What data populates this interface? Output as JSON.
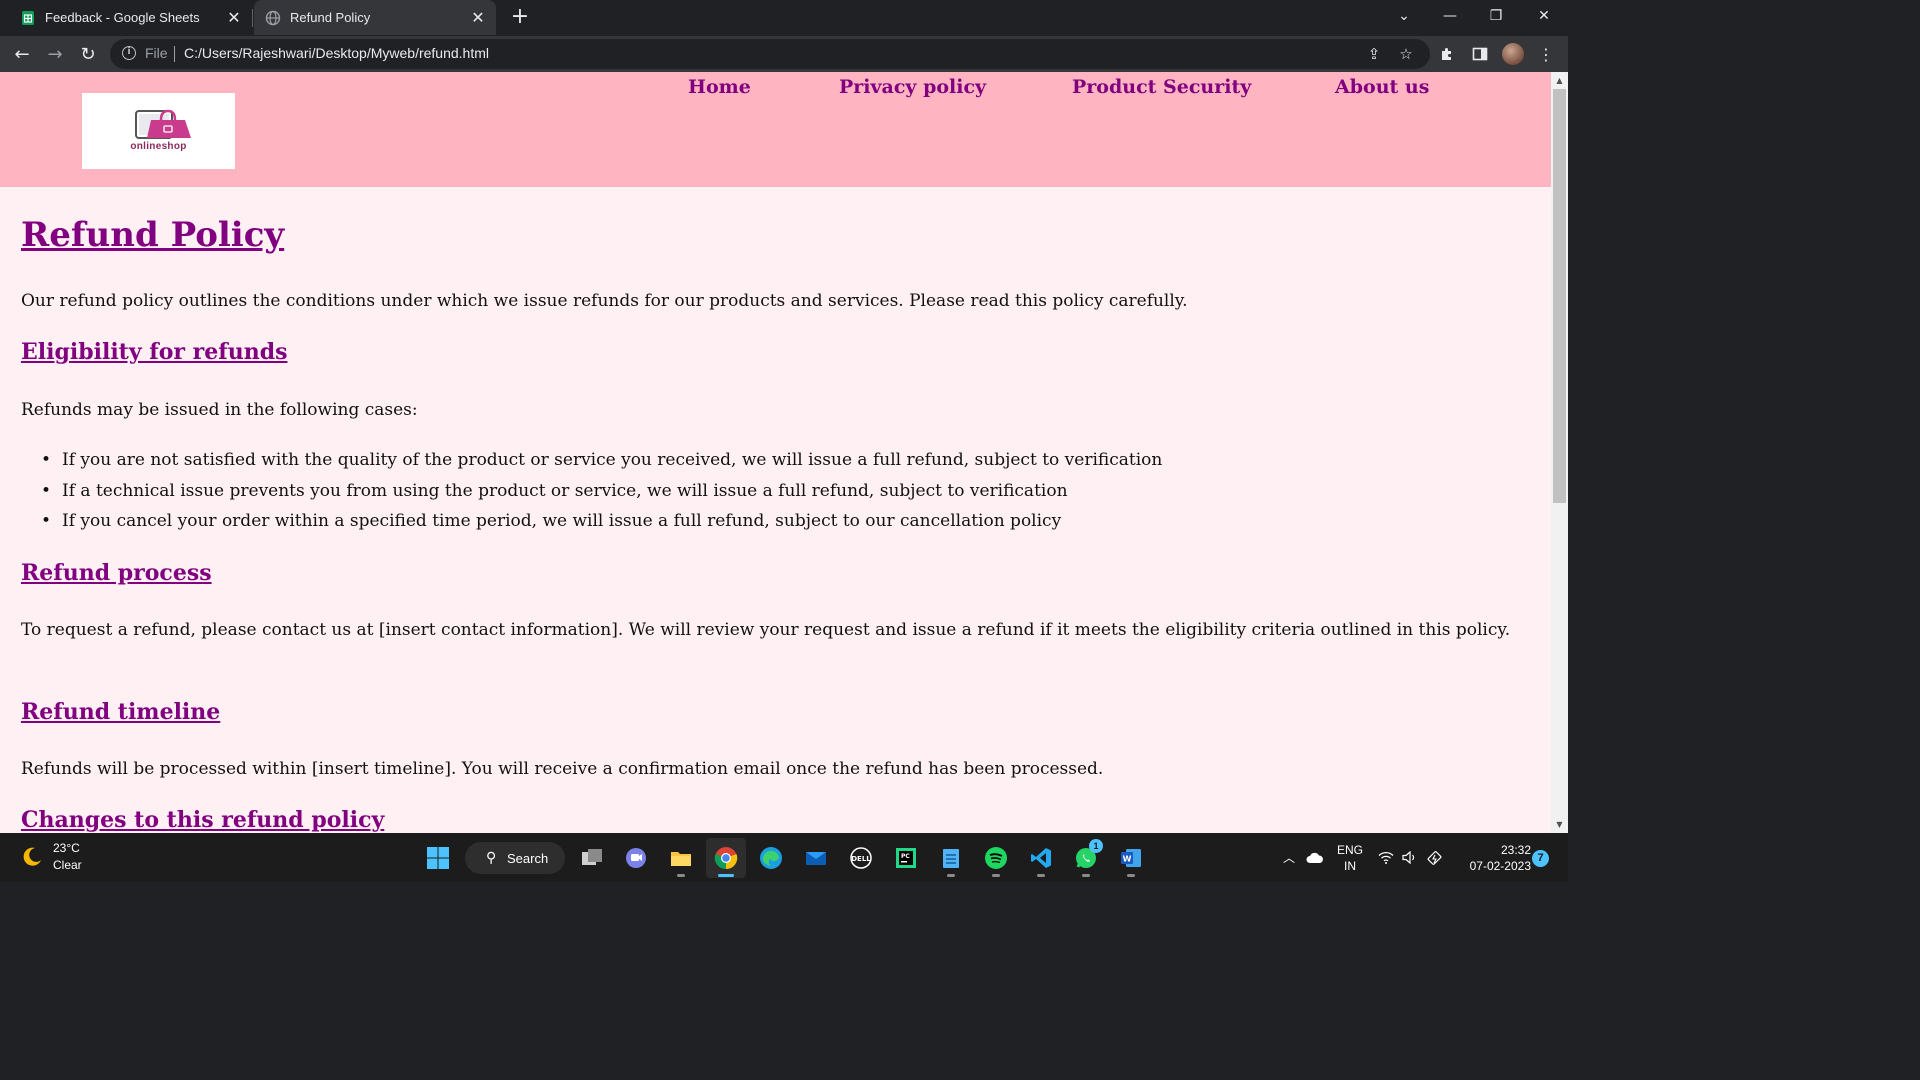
{
  "browser": {
    "tabs": [
      {
        "label": "Feedback - Google Sheets",
        "favicon": "google-sheets-icon",
        "active": false
      },
      {
        "label": "Refund Policy",
        "favicon": "globe-icon",
        "active": true
      }
    ],
    "address": {
      "scheme_label": "File",
      "url": "C:/Users/Rajeshwari/Desktop/Myweb/refund.html"
    },
    "colors": {
      "tabstrip": "#202124",
      "toolbar": "#35363a"
    }
  },
  "site": {
    "logo_text": "onlineshop",
    "nav": [
      "Home",
      "Privacy policy",
      "Product Security",
      "About us"
    ],
    "colors": {
      "header": "#ffb5c1",
      "background": "#fff0f3",
      "link": "#800080"
    }
  },
  "page": {
    "title": "Refund Policy",
    "intro": "Our refund policy outlines the conditions under which we issue refunds for our products and services. Please read this policy carefully.",
    "eligibility": {
      "heading": "Eligibility for refunds",
      "lead": "Refunds may be issued in the following cases:",
      "items": [
        "If you are not satisfied with the quality of the product or service you received, we will issue a full refund, subject to verification",
        "If a technical issue prevents you from using the product or service, we will issue a full refund, subject to verification",
        "If you cancel your order within a specified time period, we will issue a full refund, subject to our cancellation policy"
      ]
    },
    "process": {
      "heading": "Refund process",
      "text": "To request a refund, please contact us at [insert contact information]. We will review your request and issue a refund if it meets the eligibility criteria outlined in this policy."
    },
    "timeline": {
      "heading": "Refund timeline",
      "text": "Refunds will be processed within [insert timeline]. You will receive a confirmation email once the refund has been processed."
    },
    "changes": {
      "heading": "Changes to this refund policy"
    }
  },
  "taskbar": {
    "weather": {
      "temp": "23°C",
      "desc": "Clear"
    },
    "search_label": "Search",
    "apps": [
      "windows-start-icon",
      "task-view-icon",
      "teams-chat-icon",
      "file-explorer-icon",
      "chrome-icon",
      "edge-icon",
      "mail-icon",
      "dell-icon",
      "pycharm-icon",
      "notepad-icon",
      "spotify-icon",
      "vscode-icon",
      "whatsapp-icon",
      "word-icon"
    ],
    "whatsapp_badge": "1",
    "lang_line1": "ENG",
    "lang_line2": "IN",
    "time": "23:32",
    "date": "07-02-2023",
    "notifications": "7"
  }
}
